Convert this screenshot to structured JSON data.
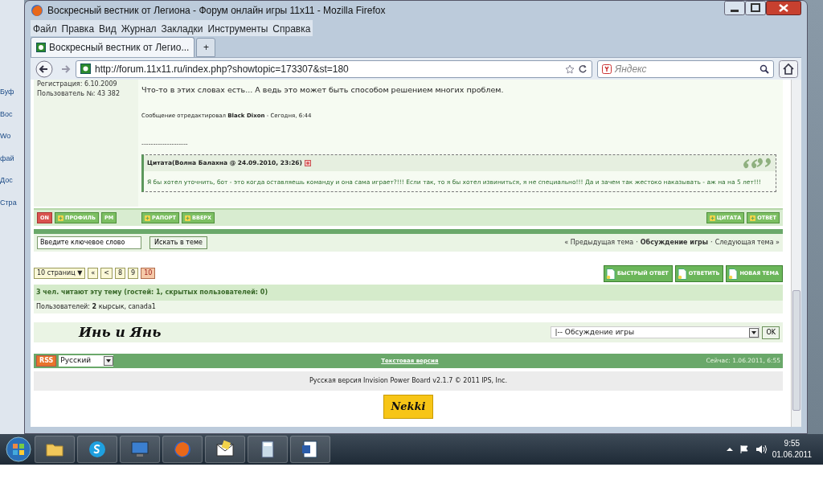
{
  "background_window": {
    "fragments": [
      "Буф",
      "Вос",
      "Wo",
      "фай",
      "Дос",
      "Стра"
    ]
  },
  "window": {
    "title": "Воскресный вестник от Легиона - Форум онлайн игры 11х11 - Mozilla Firefox",
    "menu": [
      "Файл",
      "Правка",
      "Вид",
      "Журнал",
      "Закладки",
      "Инструменты",
      "Справка"
    ],
    "tabs": [
      {
        "label": "Воскресный вестник от Легио...",
        "selected": true
      }
    ],
    "new_tab": "+",
    "url": "http://forum.11x11.ru/index.php?showtopic=173307&st=180",
    "search": {
      "placeholder": "Яндекс"
    }
  },
  "post": {
    "registration": "Регистрация: 6.10.2009",
    "user_number": "Пользователь №: 43 382",
    "text": "Что-то в этих словах есть... А ведь это может быть способом решением многих проблем.",
    "edit_note": "Сообщение отредактировал **Black Dixon** - Сегодня, 6:44",
    "separator": "--------------------",
    "quote": {
      "header": "Цитата(Волна Балахна @ 24.09.2010, 23:26)",
      "text": "Я бы хотел уточнить, бот - это когда оставляешь команду и она сама играет?!!! Если так, то я бы хотел извиниться, я не специально!!! Да и зачем так жестоко наказывать - аж на на 5 лет!!!"
    }
  },
  "post_buttons": {
    "author": [
      {
        "label": "ON",
        "kind": "status"
      },
      {
        "label": "ПРОФИЛЬ",
        "kind": "icon"
      },
      {
        "label": "PM",
        "kind": "plain"
      }
    ],
    "middle": [
      {
        "label": "РАПОРТ",
        "kind": "icon"
      },
      {
        "label": "ВВЕРХ",
        "kind": "icon"
      }
    ],
    "right": [
      {
        "label": "ЦИТАТА",
        "kind": "icon"
      },
      {
        "label": "ОТВЕТ",
        "kind": "icon"
      }
    ]
  },
  "topic_search": {
    "value": "Введите ключевое слово",
    "button": "Искать в теме"
  },
  "topic_nav": {
    "previous": "« Предыдущая тема",
    "current": "Обсуждение игры",
    "separators": [
      "·",
      "·"
    ],
    "next": "Следующая тема »"
  },
  "pagination": [
    {
      "label": "10 страниц ▼",
      "selected": false
    },
    {
      "label": "«",
      "selected": false
    },
    {
      "label": "<",
      "selected": false
    },
    {
      "label": "8",
      "selected": false
    },
    {
      "label": "9",
      "selected": false
    },
    {
      "label": "10",
      "selected": true
    }
  ],
  "actions": [
    "БЫСТРЫЙ ОТВЕТ",
    "ОТВЕТИТЬ",
    "НОВАЯ ТЕМА"
  ],
  "readers": {
    "title": "3 чел. читают эту тему (гостей: 1, скрытых пользователей: 0)",
    "label": "Пользователей:",
    "count": "2",
    "users": [
      "кырсык",
      "canada1"
    ],
    "separators": [
      ","
    ]
  },
  "forum_logo": "Инь и Янь",
  "jump": {
    "value": "|-- Обсуждение игры",
    "button": "OK"
  },
  "footer": {
    "rss": "RSS",
    "language": "Русский",
    "text_version": "Текстовая версия",
    "now": "Сейчас: 1.06.2011, 6:55"
  },
  "copyright": "Русская версия Invision Power Board v2.1.7 © 2011  IPS, Inc.",
  "sponsor_logo": "Nekki",
  "taskbar": {
    "time": "9:55",
    "date": "01.06.2011"
  }
}
